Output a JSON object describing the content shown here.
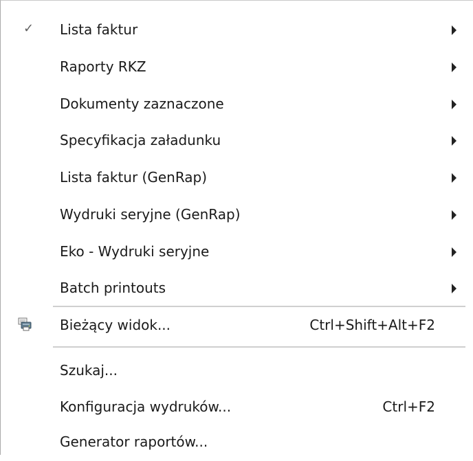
{
  "menu": {
    "items": [
      {
        "label": "Lista faktur",
        "checked": true,
        "submenu": true
      },
      {
        "label": "Raporty RKZ",
        "submenu": true
      },
      {
        "label": "Dokumenty zaznaczone",
        "submenu": true
      },
      {
        "label": "Specyfikacja załadunku",
        "submenu": true
      },
      {
        "label": "Lista faktur (GenRap)",
        "submenu": true
      },
      {
        "label": "Wydruki seryjne (GenRap)",
        "submenu": true
      },
      {
        "label": "Eko - Wydruki seryjne",
        "submenu": true
      },
      {
        "label": "Batch printouts",
        "submenu": true
      },
      {
        "label": "Bieżący widok...",
        "shortcut": "Ctrl+Shift+Alt+F2",
        "icon": "printer-icon"
      },
      {
        "label": "Szukaj..."
      },
      {
        "label": "Konfiguracja wydruków...",
        "shortcut": "Ctrl+F2"
      },
      {
        "label": "Generator raportów..."
      }
    ],
    "check_glyph": "✓"
  }
}
